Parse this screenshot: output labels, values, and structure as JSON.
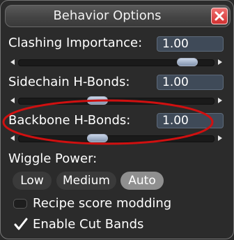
{
  "dialog": {
    "title": "Behavior Options",
    "close_icon": "close-icon"
  },
  "settings": [
    {
      "label": "Clashing Importance:",
      "value": "1.00",
      "slider_level": 0.9
    },
    {
      "label": "Sidechain H-Bonds:",
      "value": "1.00",
      "slider_level": 0.39
    },
    {
      "label": "Backbone H-Bonds:",
      "value": "1.00",
      "slider_level": 0.39
    }
  ],
  "wiggle_power": {
    "label": "Wiggle Power:",
    "options": [
      "Low",
      "Medium",
      "Auto"
    ],
    "selected": "Auto"
  },
  "options": {
    "recipe_score_modding": {
      "label": "Recipe score modding",
      "checked": false
    },
    "enable_cut_bands": {
      "label": "Enable Cut Bands",
      "checked": true
    }
  },
  "annotation": {
    "highlight_color": "#d01010"
  }
}
